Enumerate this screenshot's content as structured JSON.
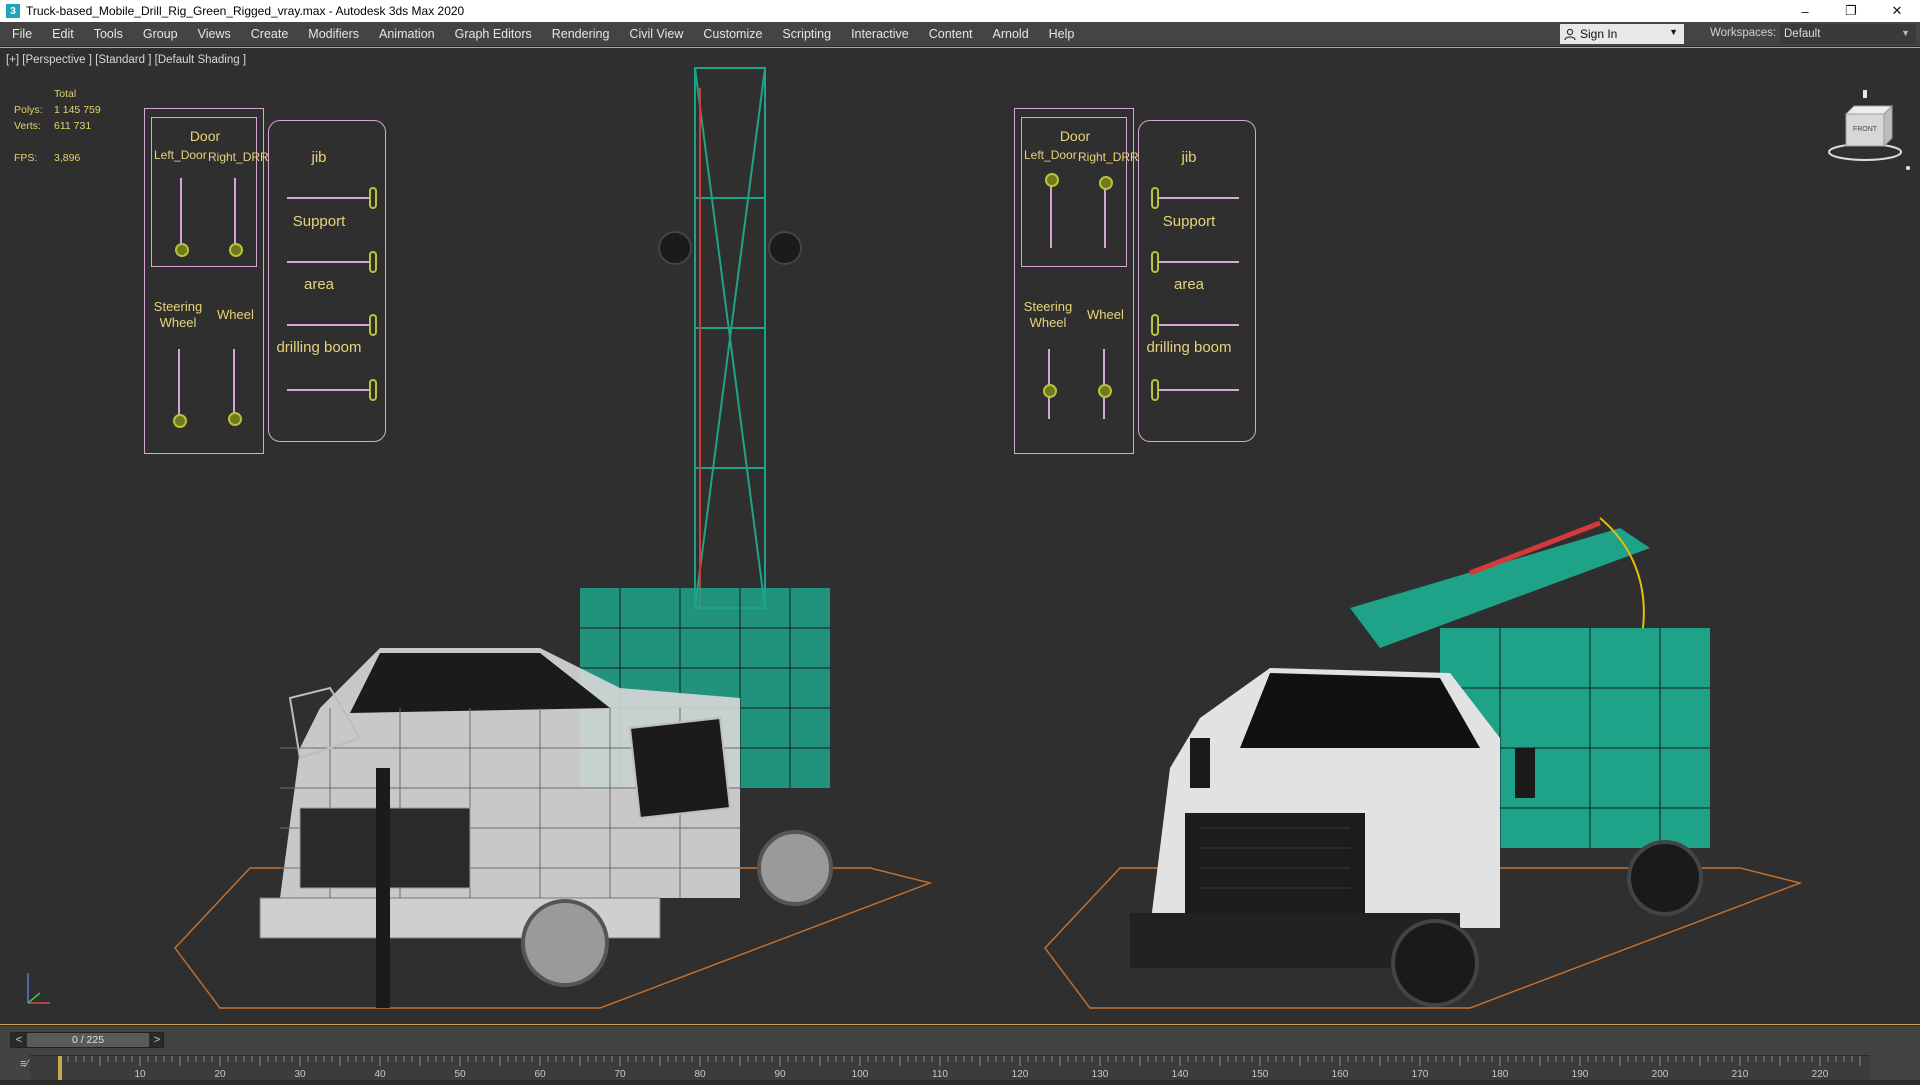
{
  "window": {
    "title": "Truck-based_Mobile_Drill_Rig_Green_Rigged_vray.max - Autodesk 3ds Max 2020",
    "app_icon": "3",
    "controls": [
      "–",
      "❐",
      "✕"
    ]
  },
  "menu": {
    "items": [
      "File",
      "Edit",
      "Tools",
      "Group",
      "Views",
      "Create",
      "Modifiers",
      "Animation",
      "Graph Editors",
      "Rendering",
      "Civil View",
      "Customize",
      "Scripting",
      "Interactive",
      "Content",
      "Arnold",
      "Help"
    ],
    "sign_in": "Sign In",
    "workspaces_label": "Workspaces:",
    "workspace_value": "Default"
  },
  "viewport": {
    "label": "[+] [Perspective ] [Standard ] [Default Shading ]",
    "stats": {
      "header": "Total",
      "polys_label": "Polys:",
      "polys_value": "1 145 759",
      "verts_label": "Verts:",
      "verts_value": "611 731",
      "fps_label": "FPS:",
      "fps_value": "3,896"
    },
    "viewcube_face": "FRONT",
    "rig_panels": {
      "door_title": "Door",
      "left_door": "Left_Door",
      "right_door": "Right_DRR",
      "steering_1": "Steering",
      "steering_2": "Wheel",
      "wheel": "Wheel",
      "jib": "jib",
      "support": "Support",
      "area": "area",
      "drilling_boom": "drilling boom"
    },
    "colors": {
      "rig_green": "#1fa388",
      "panel_border": "#d9a4d6",
      "ground_outline": "#c8722e",
      "stats_text": "#e3d36a",
      "viewport_border": "#c8a64a"
    }
  },
  "timeline": {
    "frame_display": "0 / 225",
    "prev": "<",
    "next": ">",
    "ruler_labels": [
      "10",
      "20",
      "30",
      "40",
      "50",
      "60",
      "70",
      "80",
      "90",
      "100",
      "110",
      "120",
      "130",
      "140",
      "150",
      "160",
      "170",
      "180",
      "190",
      "200",
      "210",
      "220"
    ],
    "curve_button": "≡⁄"
  }
}
